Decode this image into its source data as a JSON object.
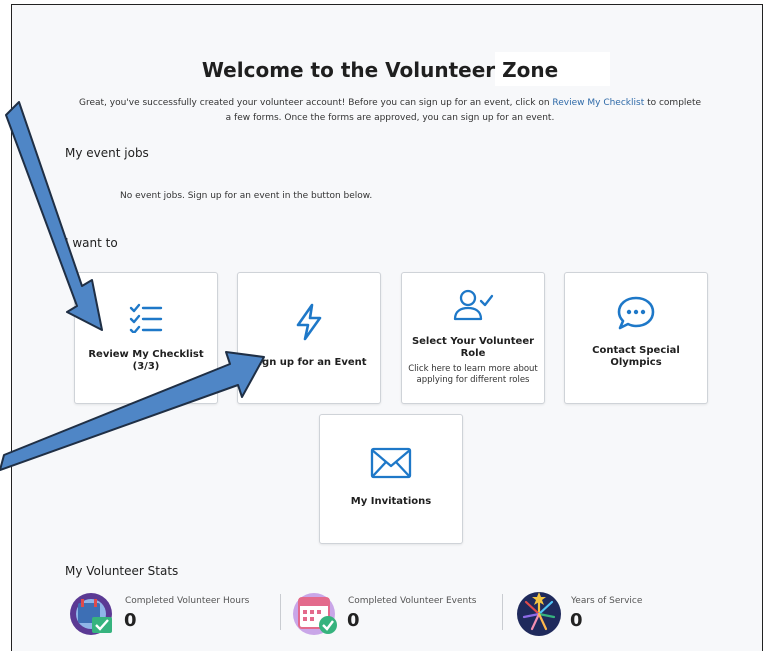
{
  "header": {
    "title": "Welcome to the Volunteer Zone"
  },
  "intro": {
    "line1_before": "Great, you've successfully created your volunteer account! Before you can sign up for an event, click on ",
    "line1_link": "Review My Checklist",
    "line1_after": " to complete",
    "line2": "a few forms. Once the forms are approved, you can sign up for an event."
  },
  "event_jobs": {
    "heading": "My event jobs",
    "empty_message": "No event jobs. Sign up for an event in the button below."
  },
  "actions": {
    "heading": "I want to",
    "cards": [
      {
        "label": "Review My Checklist (3/3)",
        "icon": "checklist-icon"
      },
      {
        "label": "Sign up for an Event",
        "icon": "lightning-icon"
      },
      {
        "label": "Select Your Volunteer Role",
        "sub": "Click here to learn more about applying for different roles",
        "icon": "user-check-icon"
      },
      {
        "label": "Contact Special Olympics",
        "icon": "chat-bubble-icon"
      },
      {
        "label": "My Invitations",
        "icon": "envelope-icon"
      }
    ]
  },
  "stats": {
    "heading": "My Volunteer Stats",
    "items": [
      {
        "label": "Completed Volunteer Hours",
        "value": "0",
        "icon": "clock-check-icon"
      },
      {
        "label": "Completed Volunteer Events",
        "value": "0",
        "icon": "calendar-check-icon"
      },
      {
        "label": "Years of Service",
        "value": "0",
        "icon": "fireworks-icon"
      }
    ]
  },
  "colors": {
    "accent": "#2f6aa8",
    "icon_blue": "#1e78c8",
    "arrow_fill": "#4f86c6",
    "arrow_stroke": "#1f2f45"
  }
}
